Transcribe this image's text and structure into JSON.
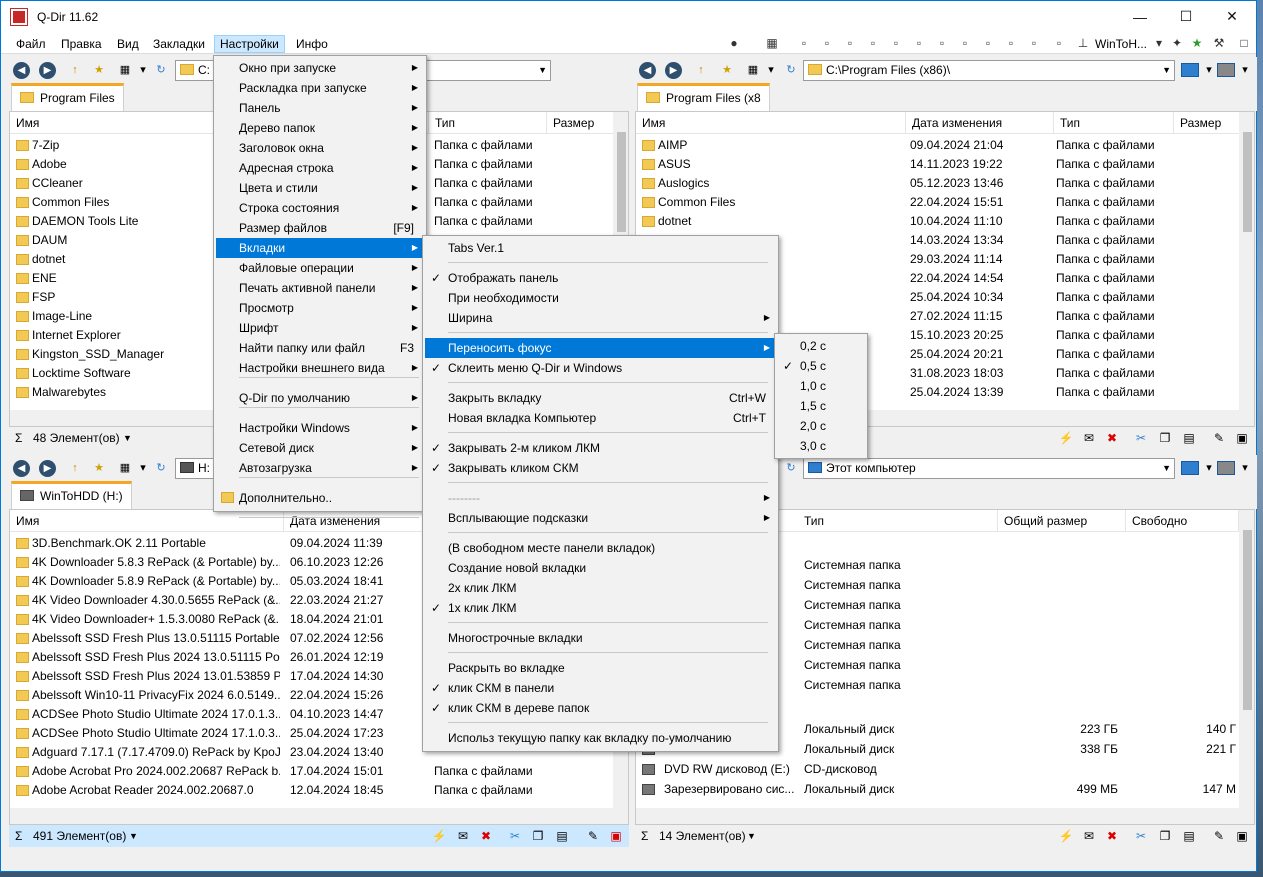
{
  "window": {
    "title": "Q-Dir 11.62"
  },
  "menubar": [
    "Файл",
    "Правка",
    "Вид",
    "Закладки",
    "Настройки",
    "Инфо"
  ],
  "toolbar": {
    "drive_label": "WinToH..."
  },
  "panes": {
    "tl": {
      "address": "C:",
      "tab": "Program Files",
      "cols": [
        "Имя",
        "Тип",
        "Размер"
      ],
      "rows": [
        [
          "7-Zip",
          "Папка с файлами"
        ],
        [
          "Adobe",
          "Папка с файлами"
        ],
        [
          "CCleaner",
          "Папка с файлами"
        ],
        [
          "Common Files",
          "Папка с файлами"
        ],
        [
          "DAEMON Tools Lite",
          "Папка с файлами"
        ],
        [
          "DAUM",
          ""
        ],
        [
          "dotnet",
          ""
        ],
        [
          "ENE",
          ""
        ],
        [
          "FSP",
          ""
        ],
        [
          "Image-Line",
          ""
        ],
        [
          "Internet Explorer",
          ""
        ],
        [
          "Kingston_SSD_Manager",
          ""
        ],
        [
          "Locktime Software",
          ""
        ],
        [
          "Malwarebytes",
          ""
        ]
      ],
      "status": "48 Элемент(ов)"
    },
    "tr": {
      "address": "C:\\Program Files (x86)\\",
      "tab": "Program Files (x8",
      "cols": [
        "Имя",
        "Дата изменения",
        "Тип",
        "Размер"
      ],
      "rows": [
        [
          "AIMP",
          "09.04.2024 21:04",
          "Папка с файлами"
        ],
        [
          "ASUS",
          "14.11.2023 19:22",
          "Папка с файлами"
        ],
        [
          "Auslogics",
          "05.12.2023 13:46",
          "Папка с файлами"
        ],
        [
          "Common Files",
          "22.04.2024 15:51",
          "Папка с файлами"
        ],
        [
          "dotnet",
          "10.04.2024 11:10",
          "Папка с файлами"
        ],
        [
          "",
          "14.03.2024 13:34",
          "Папка с файлами"
        ],
        [
          "",
          "29.03.2024 11:14",
          "Папка с файлами"
        ],
        [
          "",
          "22.04.2024 14:54",
          "Папка с файлами"
        ],
        [
          "",
          "25.04.2024 10:34",
          "Папка с файлами"
        ],
        [
          "",
          "27.02.2024 11:15",
          "Папка с файлами"
        ],
        [
          "",
          "15.10.2023 20:25",
          "Папка с файлами"
        ],
        [
          "",
          "25.04.2024 20:21",
          "Папка с файлами"
        ],
        [
          "",
          "31.08.2023 18:03",
          "Папка с файлами"
        ],
        [
          "",
          "25.04.2024 13:39",
          "Папка с файлами"
        ]
      ]
    },
    "bl": {
      "address": "H:",
      "tab": "WinToHDD (H:)",
      "cols": [
        "Имя",
        "Дата изменения"
      ],
      "rows": [
        [
          "3D.Benchmark.OK 2.11 Portable",
          "09.04.2024 11:39",
          ""
        ],
        [
          "4K Downloader 5.8.3 RePack (& Portable) by...",
          "06.10.2023 12:26",
          ""
        ],
        [
          "4K Downloader 5.8.9 RePack (& Portable) by...",
          "05.03.2024 18:41",
          ""
        ],
        [
          "4K Video Downloader 4.30.0.5655 RePack (&...",
          "22.03.2024 21:27",
          ""
        ],
        [
          "4K Video Downloader+ 1.5.3.0080 RePack (&...",
          "18.04.2024 21:01",
          ""
        ],
        [
          "Abelssoft SSD Fresh Plus 13.0.51115 Portable",
          "07.02.2024 12:56",
          ""
        ],
        [
          "Abelssoft SSD Fresh Plus 2024 13.0.51115 Por...",
          "26.01.2024 12:19",
          ""
        ],
        [
          "Abelssoft SSD Fresh Plus 2024 13.01.53859 P...",
          "17.04.2024 14:30",
          ""
        ],
        [
          "Abelssoft Win10-11 PrivacyFix 2024 6.0.5149...",
          "22.04.2024 15:26",
          ""
        ],
        [
          "ACDSee Photo Studio Ultimate 2024 17.0.1.3...",
          "04.10.2023 14:47",
          ""
        ],
        [
          "ACDSee Photo Studio Ultimate 2024 17.1.0.3...",
          "25.04.2024 17:23",
          ""
        ],
        [
          "Adguard 7.17.1 (7.17.4709.0) RePack by KpoJ...",
          "23.04.2024 13:40",
          ""
        ],
        [
          "Adobe Acrobat Pro 2024.002.20687 RePack b...",
          "17.04.2024 15:01",
          "Папка с файлами"
        ],
        [
          "Adobe Acrobat Reader 2024.002.20687.0",
          "12.04.2024 18:45",
          "Папка с файлами"
        ]
      ],
      "status": "491 Элемент(ов)"
    },
    "br": {
      "address": "Этот компьютер",
      "cols": [
        "Тип",
        "Общий размер",
        "Свободно"
      ],
      "sys": [
        "Системная папка",
        "Системная папка",
        "Системная папка",
        "Системная папка",
        "Системная папка",
        "Системная папка",
        "Системная папка"
      ],
      "drives": [
        [
          "",
          "Локальный диск",
          "223 ГБ",
          "140 Г"
        ],
        [
          "",
          "Локальный диск",
          "338 ГБ",
          "221 Г"
        ],
        [
          "DVD RW дисковод (E:)",
          "CD-дисковод",
          "",
          ""
        ],
        [
          "Зарезервировано сис...",
          "Локальный диск",
          "499 МБ",
          "147 М"
        ]
      ],
      "status": "14 Элемент(ов)"
    }
  },
  "menu_settings": [
    {
      "label": "Окно при запуске",
      "arrow": true
    },
    {
      "label": "Раскладка при запуске",
      "arrow": true
    },
    {
      "label": "Панель",
      "arrow": true
    },
    {
      "label": "Дерево папок",
      "arrow": true
    },
    {
      "label": "Заголовок окна",
      "arrow": true
    },
    {
      "label": "Адресная строка",
      "arrow": true
    },
    {
      "label": "Цвета и стили",
      "arrow": true
    },
    {
      "label": "Строка состояния",
      "arrow": true
    },
    {
      "label": "Размер файлов",
      "shortcut": "[F9]"
    },
    {
      "label": "Вкладки",
      "arrow": true,
      "hl": true
    },
    {
      "label": "Файловые операции",
      "arrow": true
    },
    {
      "label": "Печать активной панели",
      "arrow": true
    },
    {
      "label": "Просмотр",
      "arrow": true
    },
    {
      "label": "Шрифт",
      "arrow": true
    },
    {
      "label": "Найти папку или файл",
      "shortcut": "F3"
    },
    {
      "label": "Настройки внешнего вида",
      "arrow": true
    },
    {
      "label": "Q-Dir по умолчанию",
      "arrow": true
    },
    {
      "label": "Настройки Windows",
      "arrow": true
    },
    {
      "label": "Сетевой диск",
      "arrow": true
    },
    {
      "label": "Автозагрузка",
      "arrow": true
    },
    {
      "label": "Дополнительно..",
      "folder": true
    }
  ],
  "menu_tabs": [
    {
      "label": "Tabs Ver.1"
    },
    {
      "label": "Отображать панель",
      "check": true
    },
    {
      "label": "При необходимости"
    },
    {
      "label": "Ширина",
      "arrow": true
    },
    {
      "label": "Переносить фокус",
      "arrow": true,
      "hl": true
    },
    {
      "label": "Склеить меню Q-Dir и Windows",
      "check": true
    },
    {
      "label": "Закрыть вкладку",
      "shortcut": "Ctrl+W"
    },
    {
      "label": "Новая вкладка Компьютер",
      "shortcut": "Ctrl+T"
    },
    {
      "label": "Закрывать 2-м кликом ЛКМ",
      "check": true
    },
    {
      "label": "Закрывать кликом СКМ",
      "check": true
    },
    {
      "label": "--------",
      "arrow": true,
      "grey": true
    },
    {
      "label": "Всплывающие подсказки",
      "arrow": true
    },
    {
      "label": "(В свободном месте панели вкладок)"
    },
    {
      "label": "Создание новой вкладки"
    },
    {
      "label": "2х клик ЛКМ"
    },
    {
      "label": "1х клик ЛКМ",
      "check": true
    },
    {
      "label": "Многострочные вкладки"
    },
    {
      "label": "Раскрыть во вкладке"
    },
    {
      "label": "клик СКМ в панели",
      "check": true
    },
    {
      "label": "клик СКМ в дереве папок",
      "check": true
    },
    {
      "label": "Использ текущую папку как вкладку по-умолчанию"
    }
  ],
  "menu_focus": [
    {
      "label": "0,2 с"
    },
    {
      "label": "0,5 с",
      "check": true
    },
    {
      "label": "1,0 с"
    },
    {
      "label": "1,5 с"
    },
    {
      "label": "2,0 с"
    },
    {
      "label": "3,0 с"
    }
  ]
}
